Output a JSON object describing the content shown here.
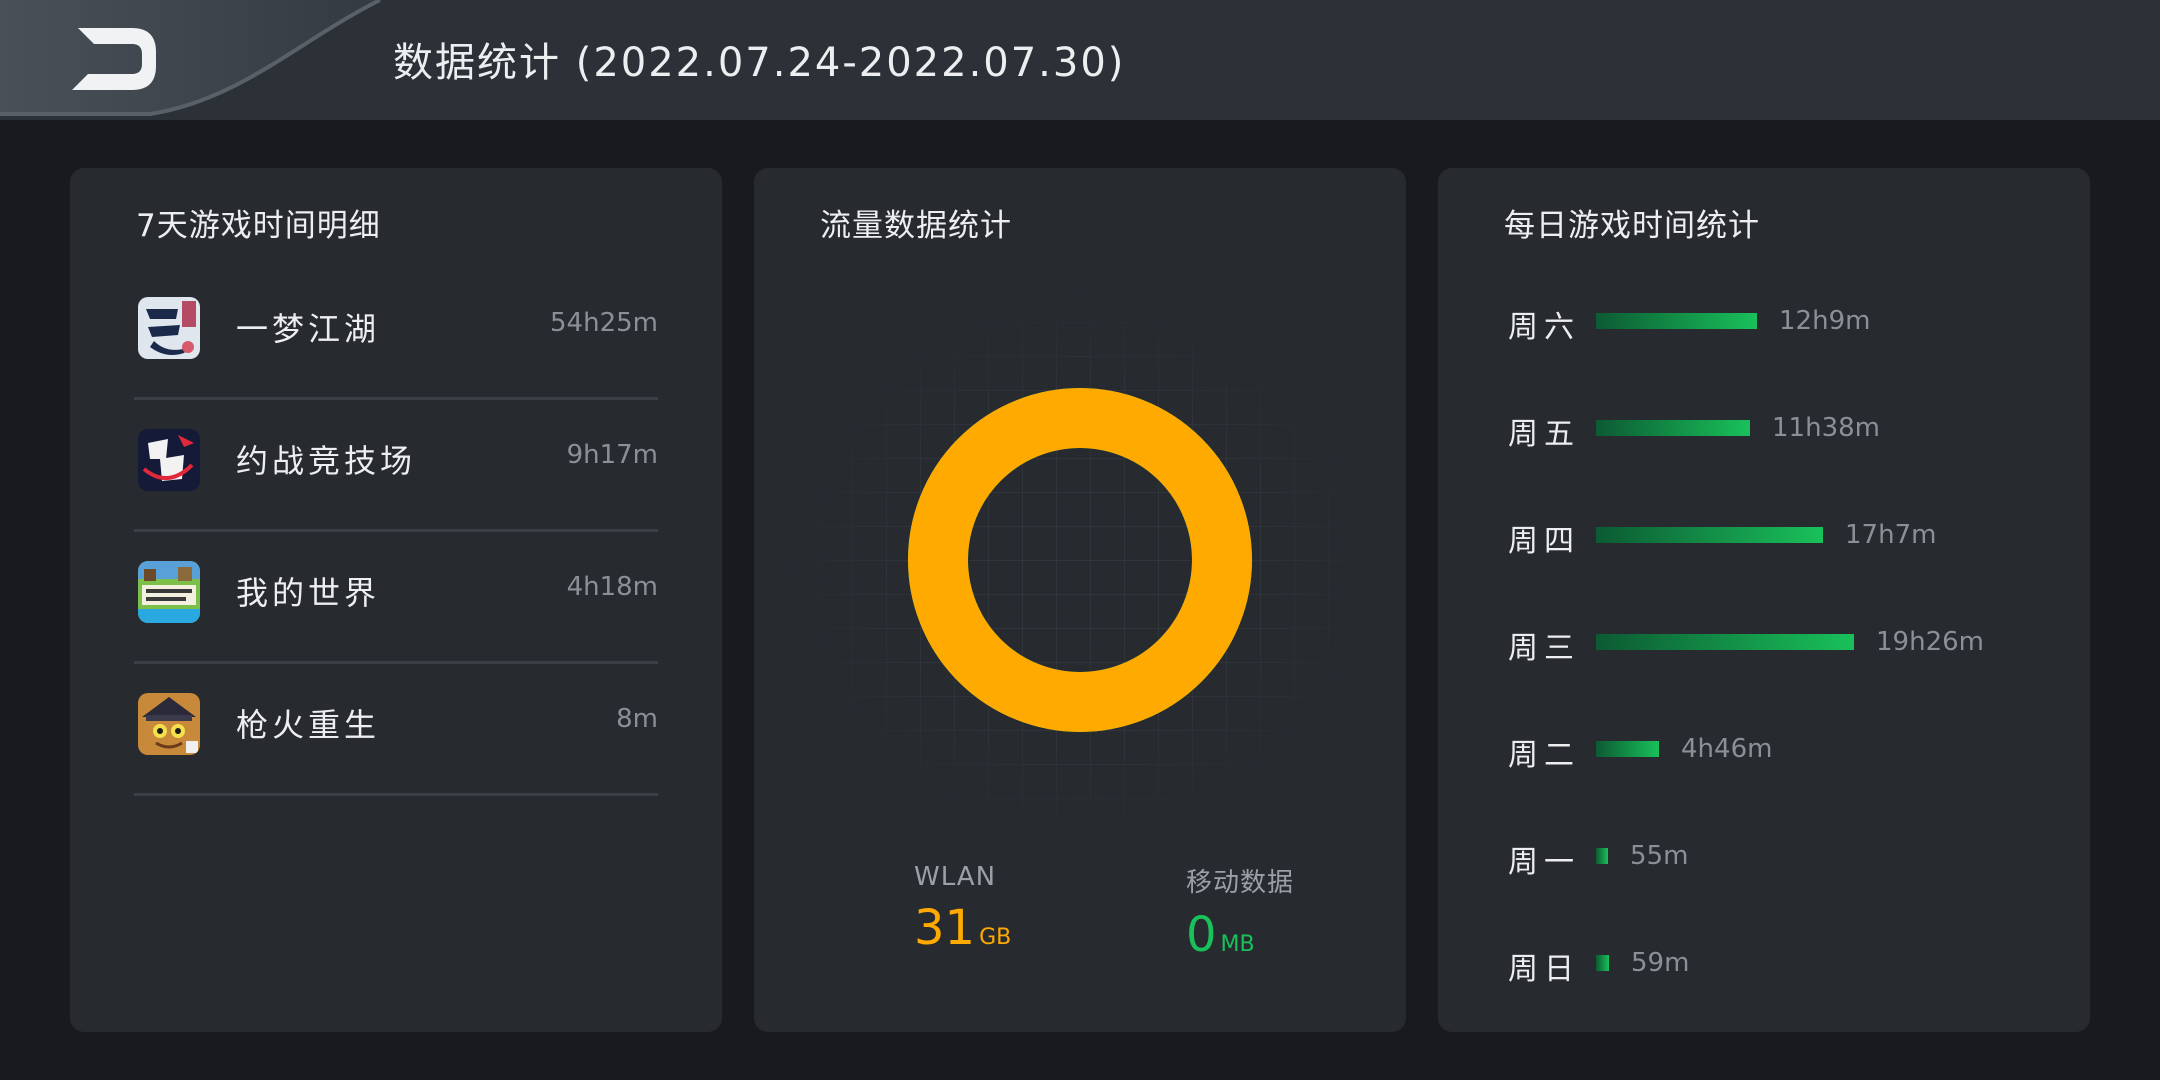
{
  "header": {
    "title": "数据统计 (2022.07.24-2022.07.30)",
    "back_icon": "back-arrow-icon"
  },
  "games_panel": {
    "title": "7天游戏时间明细",
    "items": [
      {
        "name": "一梦江湖",
        "time": "54h25m",
        "icon": "yimeng-jianghu-icon"
      },
      {
        "name": "约战竞技场",
        "time": "9h17m",
        "icon": "yuezhan-icon"
      },
      {
        "name": "我的世界",
        "time": "4h18m",
        "icon": "minecraft-icon"
      },
      {
        "name": "枪火重生",
        "time": "8m",
        "icon": "gunfire-reborn-icon"
      }
    ]
  },
  "traffic_panel": {
    "title": "流量数据统计",
    "wlan": {
      "label": "WLAN",
      "value": "31",
      "unit": "GB",
      "color": "#ffaa00"
    },
    "mobile": {
      "label": "移动数据",
      "value": "0",
      "unit": "MB",
      "color": "#19c15a"
    },
    "donut": {
      "wlan_share": 1.0,
      "mobile_share": 0.0
    }
  },
  "daily_panel": {
    "title": "每日游戏时间统计",
    "bar_color": "#19c15a"
  },
  "chart_data": {
    "type": "bar",
    "orientation": "horizontal",
    "categories": [
      "周六",
      "周五",
      "周四",
      "周三",
      "周二",
      "周一",
      "周日"
    ],
    "labels": [
      "12h9m",
      "11h38m",
      "17h7m",
      "19h26m",
      "4h46m",
      "55m",
      "59m"
    ],
    "values": [
      729,
      698,
      1027,
      1166,
      286,
      55,
      59
    ],
    "unit": "minutes"
  }
}
